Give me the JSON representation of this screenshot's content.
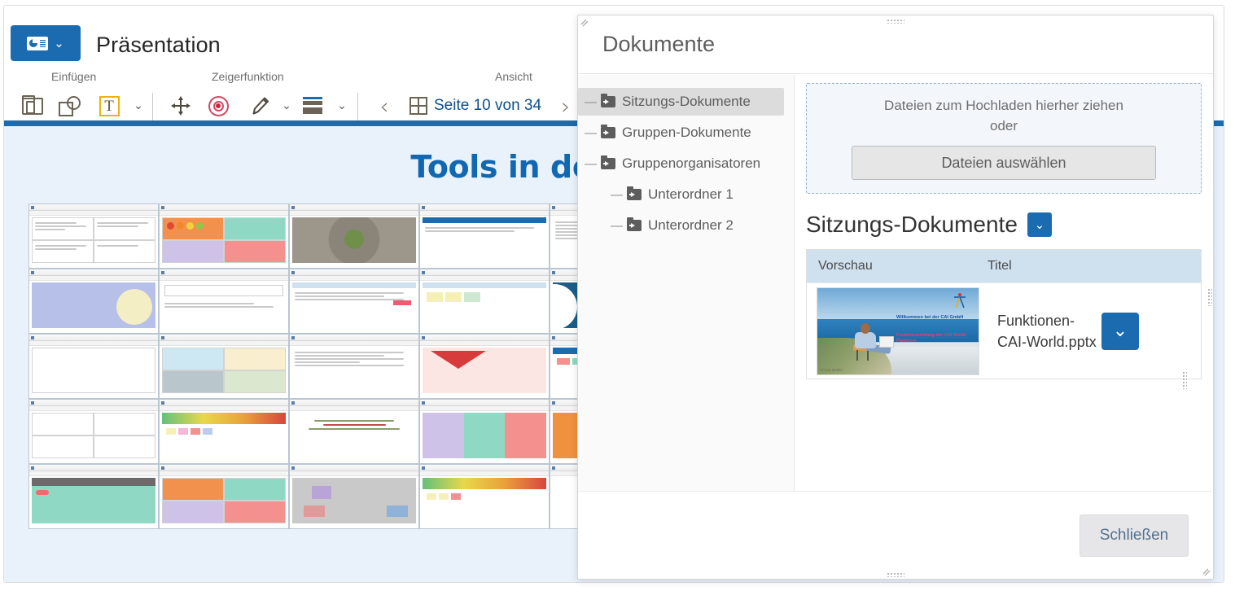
{
  "presentation": {
    "app_button_icon": "slides-icon",
    "app_button_caret": "⌄",
    "title": "Präsentation",
    "ribbon_groups": {
      "insert": "Einfügen",
      "pointer": "Zeigerfunktion",
      "view": "Ansicht"
    },
    "tools": {
      "insert_object": "insert-object-icon",
      "shape": "shape-icon",
      "textbox": "T",
      "caret": "⌄",
      "move": "move-icon",
      "laser": "laser-pointer-icon",
      "pen": "pen-icon",
      "bars": "layout-bars-icon"
    },
    "navigation": {
      "prev": "‹",
      "next": "›",
      "page_label": "Seite 10 von 34",
      "current_page": 10,
      "total_pages": 34
    },
    "slide": {
      "title": "Tools in der CAI® World"
    }
  },
  "dialog": {
    "title": "Dokumente",
    "tree": [
      {
        "label": "Sitzungs-Dokumente",
        "level": 0,
        "selected": true,
        "toggle": "—"
      },
      {
        "label": "Gruppen-Dokumente",
        "level": 0,
        "selected": false,
        "toggle": "—"
      },
      {
        "label": "Gruppenorganisatoren",
        "level": 0,
        "selected": false,
        "toggle": "—"
      },
      {
        "label": "Unterordner 1",
        "level": 1,
        "selected": false,
        "toggle": "—"
      },
      {
        "label": "Unterordner 2",
        "level": 1,
        "selected": false,
        "toggle": "—"
      }
    ],
    "dropzone": {
      "line1": "Dateien zum Hochladen hierher ziehen",
      "line2": "oder",
      "button": "Dateien auswählen"
    },
    "section": {
      "title": "Sitzungs-Dokumente",
      "chip_caret": "⌄"
    },
    "table": {
      "columns": [
        "Vorschau",
        "Titel"
      ],
      "rows": [
        {
          "title": "Funktionen-CAI-World.pptx",
          "action_caret": "⌄",
          "thumbnail": {
            "headline": "Willkommen bei der CAI GmbH",
            "subline": "Funktionsumfang der CAI World Plattform",
            "copyright": "© CAI GmbH"
          }
        }
      ]
    },
    "footer": {
      "close": "Schließen"
    }
  },
  "colors": {
    "accent_blue": "#1a6bb0",
    "table_header": "#cfe0ef",
    "slide_bg": "#e9f1fb",
    "slide_title": "#1267b1",
    "tree_selected": "#dcdcdc"
  }
}
